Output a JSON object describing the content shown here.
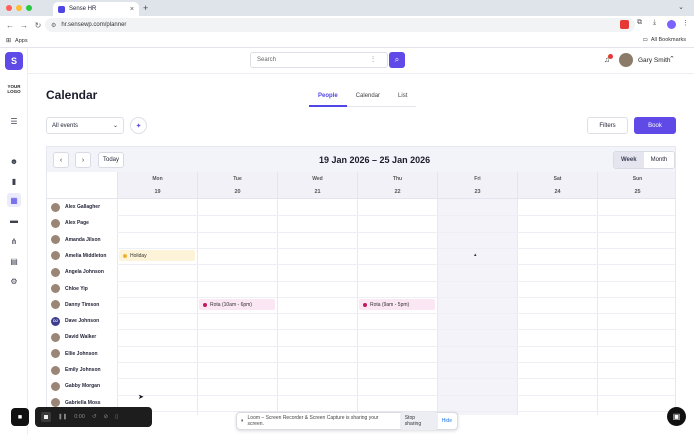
{
  "browser": {
    "tab_title": "Sense HR",
    "tab_close": "×",
    "new_tab": "+",
    "url": "hr.sensewp.com/planner",
    "bookmarks_apps": "Apps",
    "all_bookmarks": "All Bookmarks",
    "window_dots": [
      "#ff5f57",
      "#febc2e",
      "#28c840"
    ]
  },
  "sidebar": {
    "logo_letter": "S",
    "your_logo": "YOUR LOGO",
    "icons": [
      "menu-icon",
      "people-icon",
      "trash-icon",
      "calendar-icon",
      "folder-icon",
      "org-chart-icon",
      "document-icon",
      "settings-icon"
    ]
  },
  "topbar": {
    "search_placeholder": "Search",
    "user_name": "Gary Smith"
  },
  "page": {
    "title": "Calendar",
    "tabs": [
      {
        "label": "People",
        "active": true
      },
      {
        "label": "Calendar",
        "active": false
      },
      {
        "label": "List",
        "active": false
      }
    ],
    "events_filter": "All events",
    "filters_label": "Filters",
    "book_label": "Book"
  },
  "calendar": {
    "today_label": "Today",
    "range": "19 Jan 2026 – 25 Jan 2026",
    "week_label": "Week",
    "month_label": "Month",
    "days": [
      {
        "name": "Mon",
        "date": "19"
      },
      {
        "name": "Tue",
        "date": "20"
      },
      {
        "name": "Wed",
        "date": "21"
      },
      {
        "name": "Thu",
        "date": "22"
      },
      {
        "name": "Fri",
        "date": "23"
      },
      {
        "name": "Sat",
        "date": "24"
      },
      {
        "name": "Sun",
        "date": "25"
      }
    ],
    "people": [
      {
        "name": "Alex Gallagher"
      },
      {
        "name": "Alex Page"
      },
      {
        "name": "Amanda Jilson"
      },
      {
        "name": "Amelia Middleton"
      },
      {
        "name": "Angela Johnson"
      },
      {
        "name": "Chloe Yip"
      },
      {
        "name": "Danny Timson"
      },
      {
        "name": "Dave Johnson",
        "initials": "DJ"
      },
      {
        "name": "David Walker"
      },
      {
        "name": "Ellie Johnson"
      },
      {
        "name": "Emily Johnson"
      },
      {
        "name": "Gabby Morgan"
      },
      {
        "name": "Gabriella Moss"
      }
    ],
    "events": [
      {
        "label": "Holiday",
        "type": "holiday",
        "person": 3,
        "day": 0,
        "color": "#f0b429"
      },
      {
        "label": "Rota (10am - 6pm)",
        "type": "rota",
        "person": 6,
        "day": 1,
        "color": "#c2185b"
      },
      {
        "label": "Rota (9am - 5pm)",
        "type": "rota",
        "person": 6,
        "day": 3,
        "color": "#c2185b"
      }
    ]
  },
  "recorder": {
    "time": "0:00",
    "share_message": "Loom – Screen Recorder & Screen Capture is sharing your screen.",
    "stop_sharing": "Stop sharing",
    "hide": "Hide"
  },
  "colors": {
    "accent": "#5f4ae8",
    "holiday_bg": "#fdf3d8",
    "rota_bg": "#fbe6f3"
  }
}
